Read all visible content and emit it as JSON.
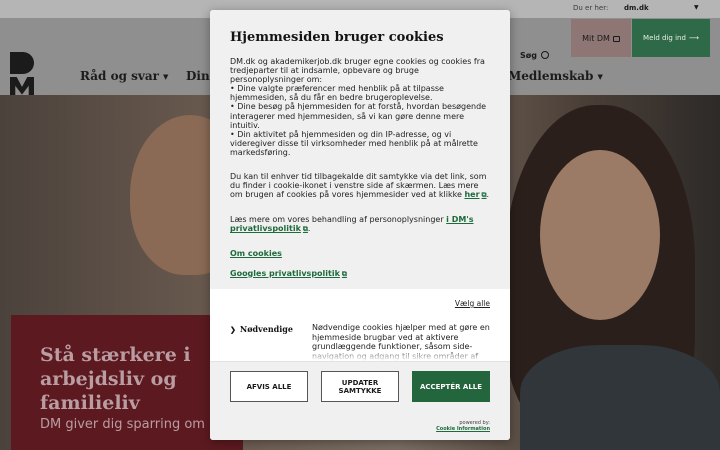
{
  "topbar": {
    "context_label": "Du er her:",
    "site_select_value": "dm.dk"
  },
  "header": {
    "logo_text": "DM",
    "nav": [
      {
        "label": "Råd og svar"
      },
      {
        "label": "Din"
      },
      {
        "label": "Medlemskab"
      }
    ],
    "search_label": "Søg",
    "my_dm_label": "Mit DM",
    "signup_label": "Meld dig ind",
    "signup_arrow": "⟶"
  },
  "hero": {
    "headline": "Stå stærkere i arbejdsliv og familieliv",
    "subtext": "DM giver dig sparring om"
  },
  "cookie_dialog": {
    "title": "Hjemmesiden bruger cookies",
    "intro": "DM.dk og akademikerjob.dk bruger egne cookies og cookies fra tredjeparter til at indsamle, opbevare og bruge personoplysninger om:",
    "bullets": [
      "• Dine valgte præferencer med henblik på at tilpasse hjemmesiden, så du får en bedre brugeroplevelse.",
      "• Dine besøg på hjemmesiden for at forstå, hvordan besøgende interagerer med hjemmesiden, så vi kan gøre denne mere intuitiv.",
      "• Din aktivitet på hjemmesiden og din IP-adresse, og vi videregiver disse til virksomheder med henblik på at målrette markedsføring."
    ],
    "withdraw_text": "Du kan til enhver tid tilbagekalde dit samtykke via det link, som du finder i cookie-ikonet i venstre side af skærmen. Læs mere om brugen af cookies på vores hjemmesider ved at klikke",
    "withdraw_link": "her",
    "privacy_text": "Læs mere om vores behandling af personoplysninger",
    "privacy_link": "i DM's privatlivspolitik",
    "privacy_end": ".",
    "about_cookies_link": "Om cookies",
    "google_privacy_link": "Googles privatlivspolitik",
    "select_all": "Vælg alle",
    "category": {
      "title": "Nødvendige",
      "description": "Nødvendige cookies hjælper med at gøre en hjemmeside brugbar ved at aktivere grundlæggende funktioner, såsom side-navigation og adgang til sikre områder af hjemmesiden."
    },
    "buttons": {
      "decline": "AFVIS ALLE",
      "update": "UPDATER SAMTYKKE",
      "accept": "ACCEPTÉR ALLE"
    },
    "powered_by_label": "powered by:",
    "powered_by_brand": "Cookie Information"
  }
}
